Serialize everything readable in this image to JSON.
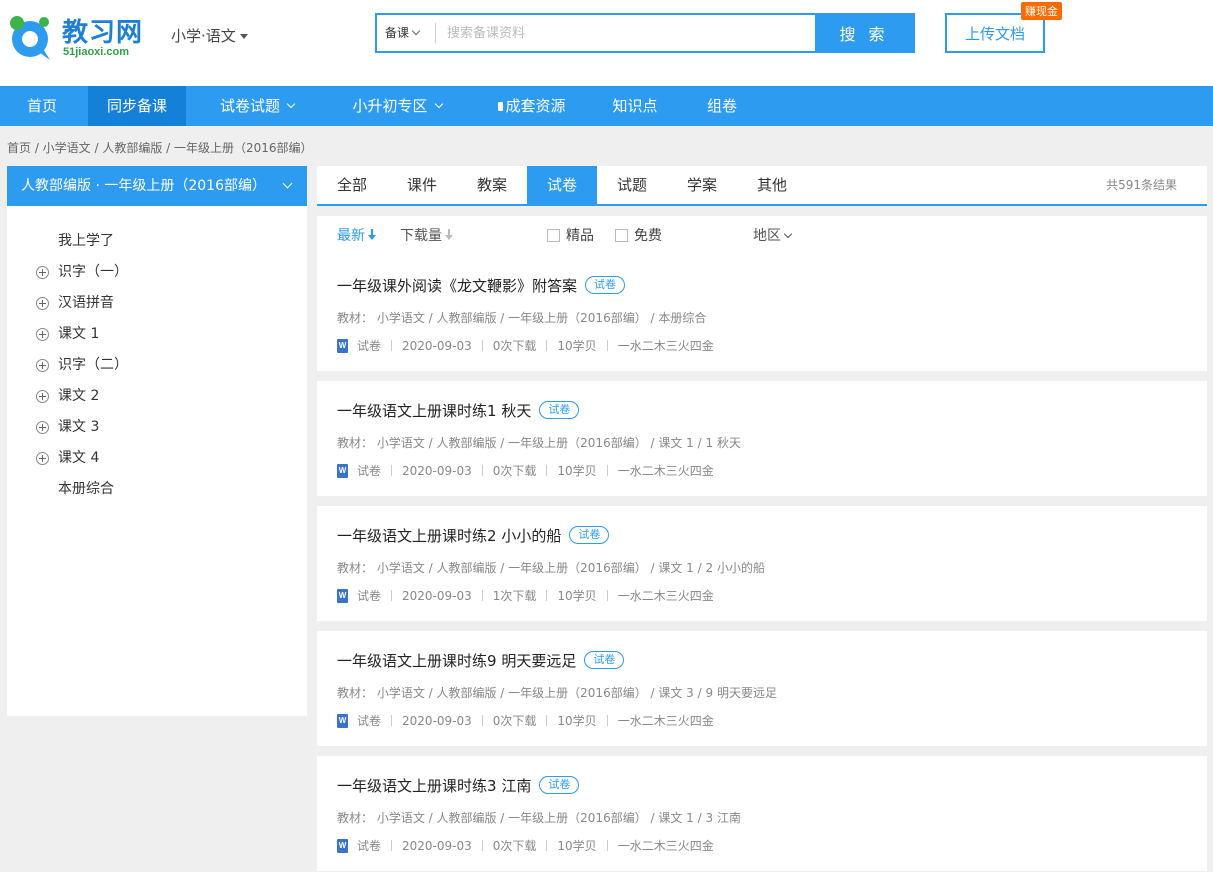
{
  "header": {
    "logo_text": "教习网",
    "logo_sub": "51jiaoxi.com",
    "grade_select": "小学·语文",
    "search": {
      "type": "备课",
      "placeholder": "搜索备课资料",
      "button": "搜 索"
    },
    "upload_button": "上传文档",
    "cash_badge": "赚现金"
  },
  "nav": {
    "items": [
      {
        "label": "首页"
      },
      {
        "label": "同步备课"
      },
      {
        "label": "试卷试题"
      },
      {
        "label": "小升初专区"
      },
      {
        "label": "成套资源"
      },
      {
        "label": "知识点"
      },
      {
        "label": "组卷"
      }
    ]
  },
  "breadcrumb": "首页 /  小学语文 / 人教部编版 / 一年级上册（2016部编）",
  "sidebar": {
    "header": "人教部编版 · 一年级上册（2016部编）",
    "items": [
      {
        "label": "我上学了"
      },
      {
        "label": "识字（一）"
      },
      {
        "label": "汉语拼音"
      },
      {
        "label": "课文 1"
      },
      {
        "label": "识字（二）"
      },
      {
        "label": "课文 2"
      },
      {
        "label": "课文 3"
      },
      {
        "label": "课文 4"
      },
      {
        "label": "本册综合"
      }
    ]
  },
  "tabs": {
    "items": [
      {
        "label": "全部"
      },
      {
        "label": "课件"
      },
      {
        "label": "教案"
      },
      {
        "label": "试卷"
      },
      {
        "label": "试题"
      },
      {
        "label": "学案"
      },
      {
        "label": "其他"
      }
    ],
    "result_count": "共591条结果"
  },
  "filters": {
    "sort_new": "最新",
    "sort_downloads": "下载量",
    "premium": "精品",
    "free": "免费",
    "region": "地区"
  },
  "results": [
    {
      "title": "一年级课外阅读《龙文鞭影》附答案",
      "tag": "试卷",
      "meta": "教材：  小学语文  /  人教部编版  /  一年级上册（2016部编）  /  本册综合",
      "type": "试卷",
      "date": "2020-09-03",
      "downloads": "0次下载",
      "price": "10学贝",
      "author": "一水二木三火四金"
    },
    {
      "title": "一年级语文上册课时练1 秋天",
      "tag": "试卷",
      "meta": "教材：  小学语文  /  人教部编版  /  一年级上册（2016部编）  /  课文 1  /  1 秋天",
      "type": "试卷",
      "date": "2020-09-03",
      "downloads": "0次下载",
      "price": "10学贝",
      "author": "一水二木三火四金"
    },
    {
      "title": "一年级语文上册课时练2 小小的船",
      "tag": "试卷",
      "meta": "教材：  小学语文  /  人教部编版  /  一年级上册（2016部编）  /  课文 1  /  2 小小的船",
      "type": "试卷",
      "date": "2020-09-03",
      "downloads": "1次下载",
      "price": "10学贝",
      "author": "一水二木三火四金"
    },
    {
      "title": "一年级语文上册课时练9 明天要远足",
      "tag": "试卷",
      "meta": "教材：  小学语文  /  人教部编版  /  一年级上册（2016部编）  /  课文 3  /  9 明天要远足",
      "type": "试卷",
      "date": "2020-09-03",
      "downloads": "0次下载",
      "price": "10学贝",
      "author": "一水二木三火四金"
    },
    {
      "title": "一年级语文上册课时练3 江南",
      "tag": "试卷",
      "meta": "教材：  小学语文  /  人教部编版  /  一年级上册（2016部编）  /  课文 1  /  3 江南",
      "type": "试卷",
      "date": "2020-09-03",
      "downloads": "0次下载",
      "price": "10学贝",
      "author": "一水二木三火四金"
    }
  ],
  "colors": {
    "accent": "#2d9bf0",
    "nav_active": "#1580d8",
    "badge": "#ff6a00"
  }
}
